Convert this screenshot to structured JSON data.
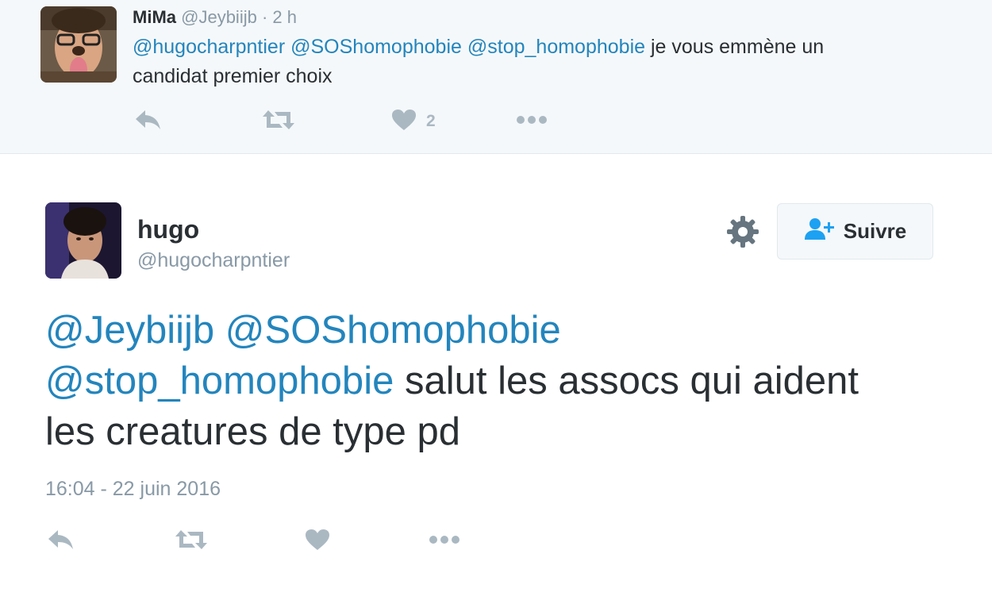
{
  "reply": {
    "name": "MiMa",
    "handle": "@Jeybiijb",
    "separator": "·",
    "time": "2 h",
    "mentions": [
      "@hugocharpntier",
      "@SOShomophobie",
      "@stop_homophobie"
    ],
    "text_line1_rest": "je vous emmène un",
    "text_line2": "candidat premier choix",
    "like_count": "2"
  },
  "tweet": {
    "name": "hugo",
    "handle": "@hugocharpntier",
    "follow_label": "Suivre",
    "mention1": "@Jeybiijb",
    "mention2": "@SOShomophobie",
    "mention3": "@stop_homophobie",
    "text_rest": "salut les assocs qui aident",
    "text_line3": "les creatures de type pd",
    "timestamp": "16:04 - 22 juin 2016"
  },
  "icons": {
    "reply": "reply-icon",
    "retweet": "retweet-icon",
    "like": "heart-icon",
    "more": "more-icon",
    "settings": "gear-icon",
    "follow": "follow-user-icon"
  },
  "colors": {
    "link": "#2385bd",
    "text": "#292f33",
    "muted": "#8899a6",
    "icon": "#aab8c2",
    "follow_icon": "#1da1f2"
  }
}
